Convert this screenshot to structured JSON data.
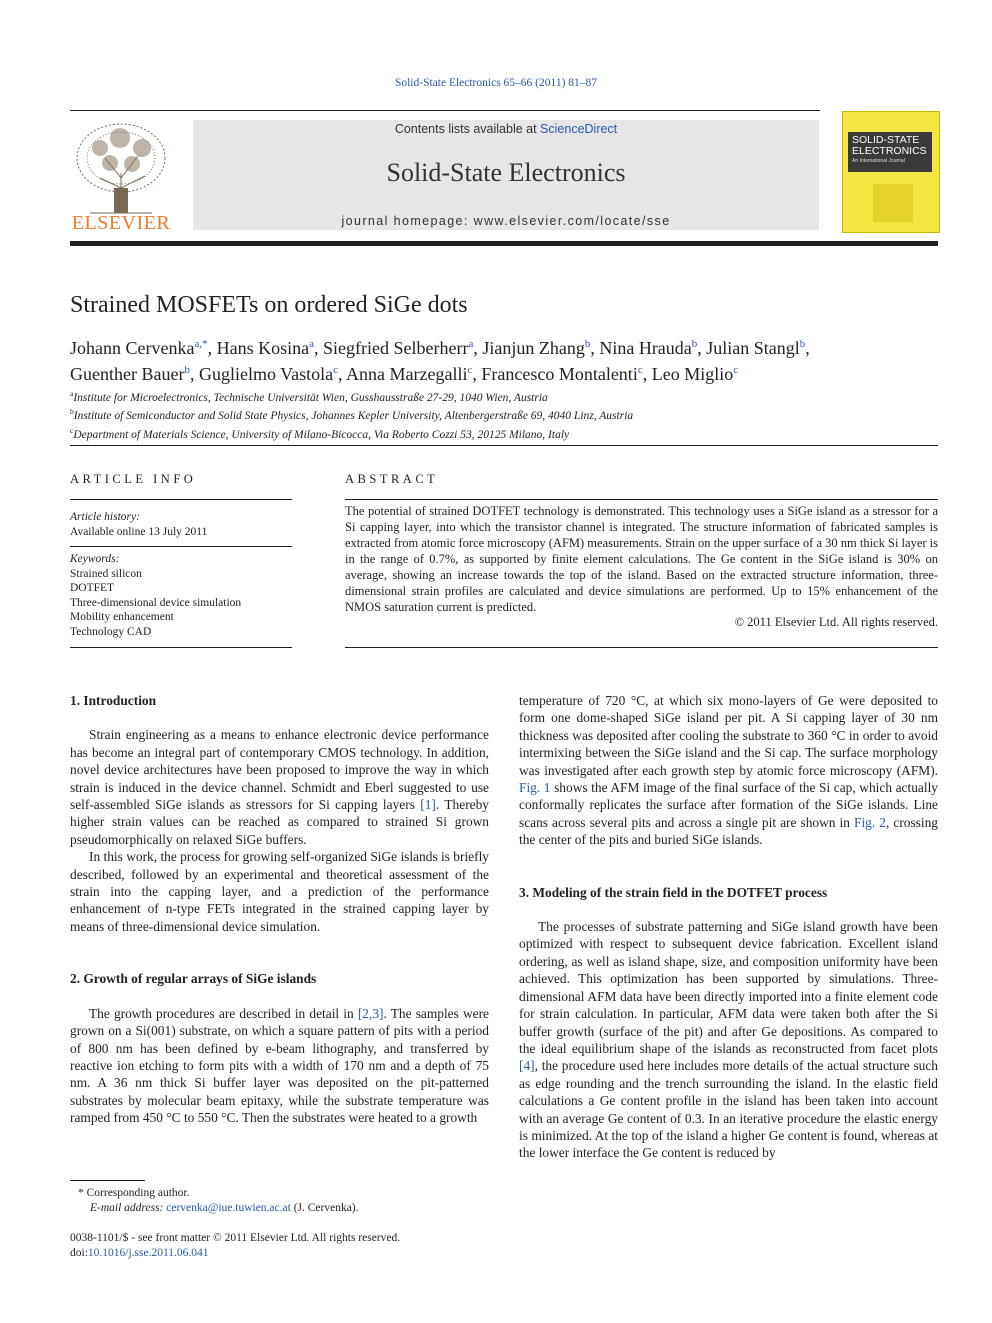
{
  "header": {
    "citation": "Solid-State Electronics 65–66 (2011) 81–87",
    "contents_prefix": "Contents lists available at ",
    "contents_link": "ScienceDirect",
    "journal_name": "Solid-State Electronics",
    "homepage_label": "journal homepage: ",
    "homepage_url_text": "www.elsevier.com/locate/sse",
    "publisher_logo_text": "ELSEVIER",
    "cover": {
      "title_line1": "SOLID-STATE",
      "title_line2": "ELECTRONICS",
      "subtitle": "An International Journal"
    }
  },
  "article": {
    "title": "Strained MOSFETs on ordered SiGe dots",
    "authors": [
      {
        "name": "Johann Cervenka",
        "sup": "a,*"
      },
      {
        "name": "Hans Kosina",
        "sup": "a"
      },
      {
        "name": "Siegfried Selberherr",
        "sup": "a"
      },
      {
        "name": "Jianjun Zhang",
        "sup": "b"
      },
      {
        "name": "Nina Hrauda",
        "sup": "b"
      },
      {
        "name": "Julian Stangl",
        "sup": "b"
      },
      {
        "name": "Guenther Bauer",
        "sup": "b"
      },
      {
        "name": "Guglielmo Vastola",
        "sup": "c"
      },
      {
        "name": "Anna Marzegalli",
        "sup": "c"
      },
      {
        "name": "Francesco Montalenti",
        "sup": "c"
      },
      {
        "name": "Leo Miglio",
        "sup": "c"
      }
    ],
    "affiliations": [
      {
        "key": "a",
        "text": "Institute for Microelectronics, Technische Universität Wien, Gusshausstraße 27-29, 1040 Wien, Austria"
      },
      {
        "key": "b",
        "text": "Institute of Semiconductor and Solid State Physics, Johannes Kepler University, Altenbergerstraße 69, 4040 Linz, Austria"
      },
      {
        "key": "c",
        "text": "Department of Materials Science, University of Milano-Bicocca, Via Roberto Cozzi 53, 20125 Milano, Italy"
      }
    ]
  },
  "article_info": {
    "heading": "ARTICLE INFO",
    "history_label": "Article history:",
    "history_value": "Available online 13 July 2011",
    "keywords_label": "Keywords:",
    "keywords": [
      "Strained silicon",
      "DOTFET",
      "Three-dimensional device simulation",
      "Mobility enhancement",
      "Technology CAD"
    ]
  },
  "abstract": {
    "heading": "ABSTRACT",
    "text": "The potential of strained DOTFET technology is demonstrated. This technology uses a SiGe island as a stressor for a Si capping layer, into which the transistor channel is integrated. The structure information of fabricated samples is extracted from atomic force microscopy (AFM) measurements. Strain on the upper surface of a 30 nm thick Si layer is in the range of 0.7%, as supported by finite element calculations. The Ge content in the SiGe island is 30% on average, showing an increase towards the top of the island. Based on the extracted structure information, three-dimensional strain profiles are calculated and device simulations are performed. Up to 15% enhancement of the NMOS saturation current is predicted.",
    "copyright": "© 2011 Elsevier Ltd. All rights reserved."
  },
  "body": {
    "sec1": {
      "heading": "1. Introduction",
      "p1_a": "Strain engineering as a means to enhance electronic device performance has become an integral part of contemporary CMOS technology. In addition, novel device architectures have been proposed to improve the way in which strain is induced in the device channel. Schmidt and Eberl suggested to use self-assembled SiGe islands as stressors for Si capping layers ",
      "p1_ref": "[1]",
      "p1_b": ". Thereby higher strain values can be reached as compared to strained Si grown pseudomorphically on relaxed SiGe buffers.",
      "p2": "In this work, the process for growing self-organized SiGe islands is briefly described, followed by an experimental and theoretical assessment of the strain into the capping layer, and a prediction of the performance enhancement of n-type FETs integrated in the strained capping layer by means of three-dimensional device simulation."
    },
    "sec2": {
      "heading": "2. Growth of regular arrays of SiGe islands",
      "p1_a": "The growth procedures are described in detail in ",
      "p1_ref": "[2,3]",
      "p1_b": ". The samples were grown on a Si(001) substrate, on which a square pattern of pits with a period of 800 nm has been defined by e-beam lithography, and transferred by reactive ion etching to form pits with a width of 170 nm and a depth of 75 nm. A 36 nm thick Si buffer layer was deposited on the pit-patterned substrates by molecular beam epitaxy, while the substrate temperature was ramped from 450 °C to 550 °C. Then the substrates were heated to a growth",
      "p1_cont_a": "temperature of 720 °C, at which six mono-layers of Ge were deposited to form one dome-shaped SiGe island per pit. A Si capping layer of 30 nm thickness was deposited after cooling the substrate to 360 °C in order to avoid intermixing between the SiGe island and the Si cap. The surface morphology was investigated after each growth step by atomic force microscopy (AFM). ",
      "p1_cont_ref1": "Fig. 1",
      "p1_cont_b": " shows the AFM image of the final surface of the Si cap, which actually conformally replicates the surface after formation of the SiGe islands. Line scans across several pits and across a single pit are shown in ",
      "p1_cont_ref2": "Fig. 2",
      "p1_cont_c": ", crossing the center of the pits and buried SiGe islands."
    },
    "sec3": {
      "heading": "3. Modeling of the strain field in the DOTFET process",
      "p1_a": "The processes of substrate patterning and SiGe island growth have been optimized with respect to subsequent device fabrication. Excellent island ordering, as well as island shape, size, and composition uniformity have been achieved. This optimization has been supported by simulations. Three-dimensional AFM data have been directly imported into a finite element code for strain calculation. In particular, AFM data were taken both after the Si buffer growth (surface of the pit) and after Ge depositions. As compared to the ideal equilibrium shape of the islands as reconstructed from facet plots ",
      "p1_ref": "[4]",
      "p1_b": ", the procedure used here includes more details of the actual structure such as edge rounding and the trench surrounding the island. In the elastic field calculations a Ge content profile in the island has been taken into account with an average Ge content of 0.3. In an iterative procedure the elastic energy is minimized. At the top of the island a higher Ge content is found, whereas at the lower interface the Ge content is reduced by"
    }
  },
  "footnotes": {
    "corresponding_mark": "*",
    "corresponding_label": "Corresponding author.",
    "email_label": "E-mail address: ",
    "email": "cervenka@iue.tuwien.ac.at",
    "email_suffix": " (J. Cervenka).",
    "issn_line": "0038-1101/$ - see front matter © 2011 Elsevier Ltd. All rights reserved.",
    "doi_label": "doi:",
    "doi": "10.1016/j.sse.2011.06.041"
  }
}
